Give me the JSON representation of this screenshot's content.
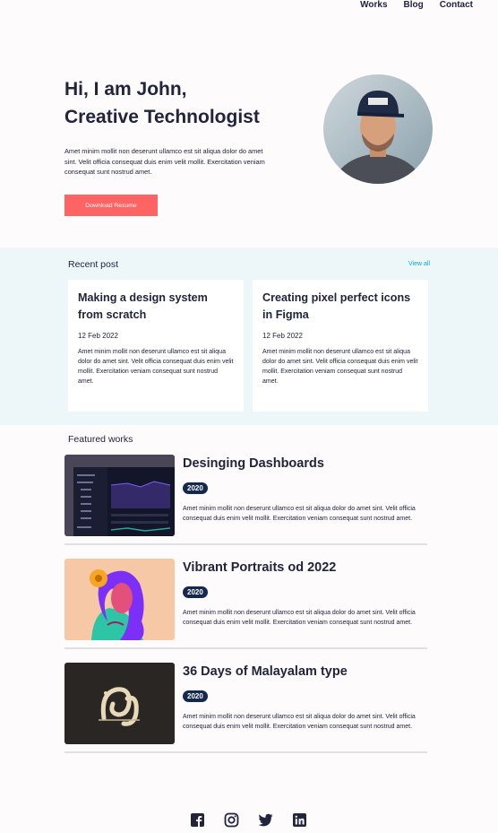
{
  "nav": {
    "items": [
      "Works",
      "Blog",
      "Contact"
    ]
  },
  "hero": {
    "title_line1": "Hi, I am John,",
    "title_line2": "Creative Technologist",
    "text": "Amet minim mollit non deserunt ullamco est sit aliqua dolor do amet sint. Velit officia consequat duis enim velit mollit. Exercitation veniam consequat sunt nostrud amet.",
    "button": "Download Resume",
    "accent": "#ff6464"
  },
  "recent": {
    "title": "Recent post",
    "view_all": "View all",
    "posts": [
      {
        "title": "Making a design system from scratch",
        "date": "12 Feb 2022",
        "text": "Amet minim mollit non deserunt ullamco est sit aliqua dolor do amet sint. Velit officia consequat duis enim velit mollit. Exercitation veniam consequat sunt nostrud amet."
      },
      {
        "title": "Creating pixel perfect icons in Figma",
        "date": "12 Feb 2022",
        "text": "Amet minim mollit non deserunt ullamco est sit aliqua dolor do amet sint. Velit officia consequat duis enim velit mollit. Exercitation veniam consequat sunt nostrud amet."
      }
    ]
  },
  "featured": {
    "title": "Featured works",
    "works": [
      {
        "title": "Desinging Dashboards",
        "year": "2020",
        "text": "Amet minim mollit non deserunt ullamco est sit aliqua dolor do amet sint. Velit officia consequat duis enim velit mollit. Exercitation veniam consequat sunt nostrud amet."
      },
      {
        "title": "Vibrant Portraits od 2022",
        "year": "2020",
        "text": "Amet minim mollit non deserunt ullamco est sit aliqua dolor do amet sint. Velit officia consequat duis enim velit mollit. Exercitation veniam consequat sunt nostrud amet."
      },
      {
        "title": "36 Days of Malayalam type",
        "year": "2020",
        "text": "Amet minim mollit non deserunt ullamco est sit aliqua dolor do amet sint. Velit officia consequat duis enim velit mollit. Exercitation veniam consequat sunt nostrud amet."
      }
    ]
  },
  "footer": {
    "icons": [
      "facebook-icon",
      "instagram-icon",
      "twitter-icon",
      "linkedin-icon"
    ]
  }
}
